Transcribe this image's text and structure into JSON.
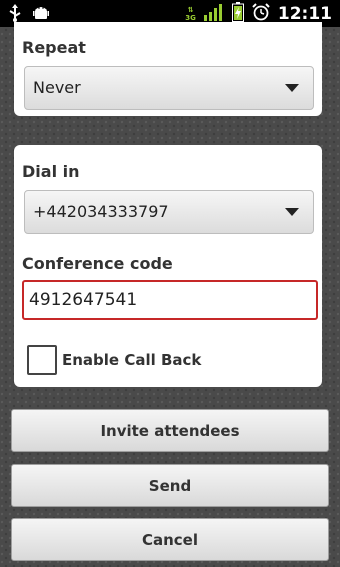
{
  "status_bar": {
    "time": "12:11",
    "network_type": "3G",
    "icons": [
      "usb-icon",
      "android-debug-icon",
      "data-arrows-icon",
      "signal-icon",
      "battery-charging-icon",
      "alarm-clock-icon"
    ]
  },
  "repeat": {
    "label": "Repeat",
    "selected": "Never"
  },
  "dial_in": {
    "label": "Dial in",
    "selected": "+442034333797"
  },
  "conference_code": {
    "label": "Conference code",
    "value": "4912647541"
  },
  "call_back": {
    "label": "Enable Call Back",
    "checked": false
  },
  "buttons": {
    "invite": "Invite attendees",
    "send": "Send",
    "cancel": "Cancel"
  },
  "colors": {
    "field_error_border": "#c62828",
    "background": "#4a4a4a",
    "network_indicator": "#9acd32"
  }
}
